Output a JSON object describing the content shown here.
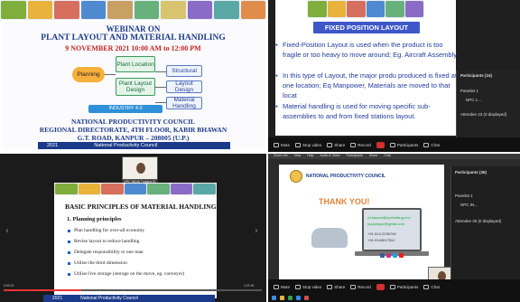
{
  "webinar": {
    "title": "WEBINAR ON",
    "subtitle": "PLANT LAYOUT AND MATERIAL HANDLING",
    "date": "9 NOVEMBER 2021  10:00 AM to 12:00 PM",
    "diagram": {
      "planning": "Planning",
      "plant_location": "Plant Location",
      "plant_layout_design": "Plant Layout Design",
      "structural": "Structural",
      "layout_design": "Layout Design",
      "material_handling": "Material Handling",
      "industry": "INDUSTRY 4.0"
    },
    "org_line1": "NATIONAL PRODUCTIVITY COUNCIL",
    "org_line2": "REGIONAL DIRECTORATE, 4TH FLOOR, KABIR BHAWAN",
    "org_line3": "G.T. ROAD, KANPUR – 208005 (U.P.)",
    "footer_year": "2021",
    "footer_org": "National Productivity Council"
  },
  "fixed_layout": {
    "heading": "FIXED POSITION LAYOUT",
    "bullets": [
      "Fixed-Position Layout is used when the product is too fragile or too heavy to move around; Eg. Aircraft Assembly",
      "In this type of Layout, the major produ produced is fixed at one location; Eq Manpower, Materials are moved to that locat",
      "Material handling is used for moving specific sub-assemblies to and from fixed stations layout."
    ],
    "participants_header": "Participants (24)",
    "panelist": "Panelist 1",
    "panelist_name": "NPC L...",
    "attendees": "Attendee 23 (0 displayed)",
    "toolbar": [
      "Mute",
      "Stop video",
      "Share",
      "Record",
      "Participants",
      "Chat"
    ]
  },
  "handling": {
    "video_name": "NPC INDIA Training ID",
    "heading": "BASIC PRINCIPLES OF MATERIAL HANDLING",
    "subheading": "1.  Planning principles",
    "items": [
      "Plan handling for over-all economy",
      "Revise layout to reduce handling",
      "Delegate responsibility to one man",
      "Utilise the third dimension",
      "Utilise live storage (storage on the move, eg. conveyor)"
    ],
    "footer_year": "2021",
    "footer_org": "National Productivity Council",
    "time_start": "0:02:21",
    "time_end": "1:21:51"
  },
  "thanks": {
    "menu": [
      "Zoom Info",
      "View",
      "Help",
      "Audio & Video",
      "Participants",
      "Share",
      "Chat"
    ],
    "org": "NATIONAL PRODUCTIVITY COUNCIL",
    "thank_you": "THANK YOU!",
    "contacts": [
      "rd-kanpur@npcindia.gov.in",
      "npckanpur@gmail.com",
      "+91-512-2296746",
      "+91-9140817512"
    ],
    "participants_header": "Participants (36)",
    "panelist": "Panelist 1",
    "panelist_name": "NPC IN...",
    "attendees": "Attendee 35 (0 displayed)",
    "toolbar": [
      "Mute",
      "Stop video",
      "Share",
      "Record",
      "Participants",
      "Chat"
    ]
  },
  "colors": {
    "navy": "#1b3a8a",
    "accent_blue": "#3d57c9",
    "red": "#c22222",
    "orange": "#e0833b"
  }
}
